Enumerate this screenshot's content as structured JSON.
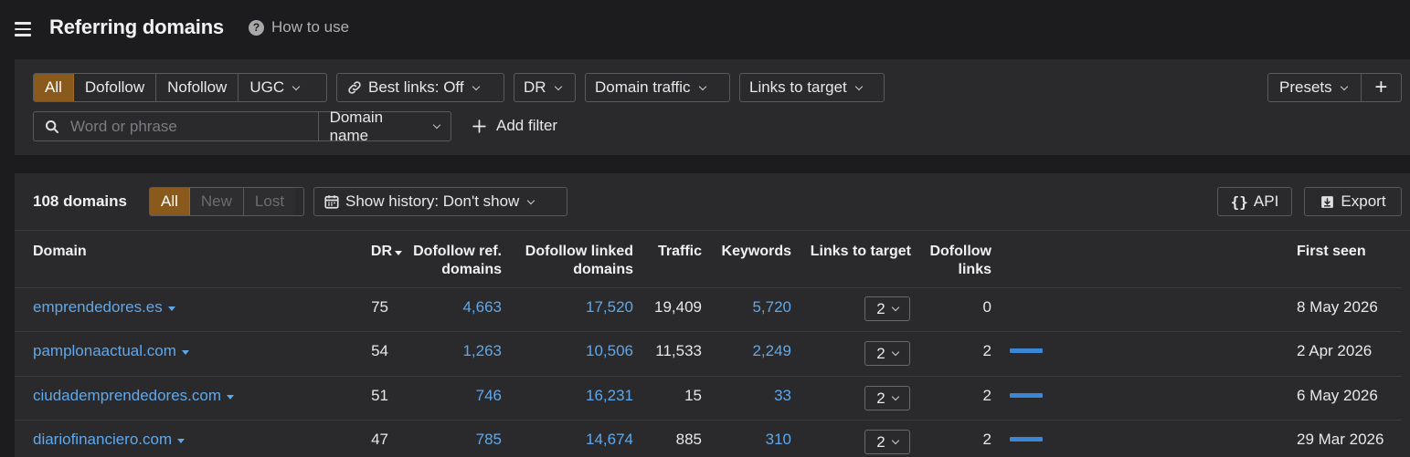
{
  "header": {
    "title": "Referring domains",
    "how_to_use": "How to use",
    "help_icon": "question-circle-icon",
    "menu_icon": "hamburger-menu-icon"
  },
  "filters": {
    "link_types": [
      "All",
      "Dofollow",
      "Nofollow",
      "UGC"
    ],
    "best_links": "Best links: Off",
    "dr": "DR",
    "domain_traffic": "Domain traffic",
    "links_to_target": "Links to target",
    "presets": "Presets",
    "plus": "+",
    "search_placeholder": "Word or phrase",
    "search_scope": "Domain name",
    "add_filter": "Add filter"
  },
  "results": {
    "count_label": "108 domains",
    "tabs": [
      "All",
      "New",
      "Lost"
    ],
    "history": "Show history: Don't show",
    "api": "API",
    "export": "Export"
  },
  "table": {
    "columns": {
      "domain": "Domain",
      "dr": "DR",
      "dofollow_ref_1": "Dofollow ref.",
      "dofollow_ref_2": "domains",
      "dofollow_linked_1": "Dofollow linked",
      "dofollow_linked_2": "domains",
      "traffic": "Traffic",
      "keywords": "Keywords",
      "links_to_target": "Links to target",
      "dofollow_links_1": "Dofollow",
      "dofollow_links_2": "links",
      "first_seen": "First seen"
    },
    "rows": [
      {
        "domain": "emprendedores.es",
        "dr": "75",
        "ref_domains": "4,663",
        "linked_domains": "17,520",
        "traffic": "19,409",
        "keywords": "5,720",
        "links_to_target": "2",
        "dofollow_links": "0",
        "bar_fraction": 0,
        "first_seen": "8 May 2026"
      },
      {
        "domain": "pamplonaactual.com",
        "dr": "54",
        "ref_domains": "1,263",
        "linked_domains": "10,506",
        "traffic": "11,533",
        "keywords": "2,249",
        "links_to_target": "2",
        "dofollow_links": "2",
        "bar_fraction": 1,
        "first_seen": "2 Apr 2026"
      },
      {
        "domain": "ciudademprendedores.com",
        "dr": "51",
        "ref_domains": "746",
        "linked_domains": "16,231",
        "traffic": "15",
        "keywords": "33",
        "links_to_target": "2",
        "dofollow_links": "2",
        "bar_fraction": 1,
        "first_seen": "6 May 2026"
      },
      {
        "domain": "diariofinanciero.com",
        "dr": "47",
        "ref_domains": "785",
        "linked_domains": "14,674",
        "traffic": "885",
        "keywords": "310",
        "links_to_target": "2",
        "dofollow_links": "2",
        "bar_fraction": 1,
        "first_seen": "29 Mar 2026"
      }
    ]
  },
  "colors": {
    "accent": "#8a5a1c",
    "link": "#5fa8ec",
    "bar": "#3b87d6",
    "background": "#1c1c1e",
    "panel": "#2a2a2c"
  }
}
